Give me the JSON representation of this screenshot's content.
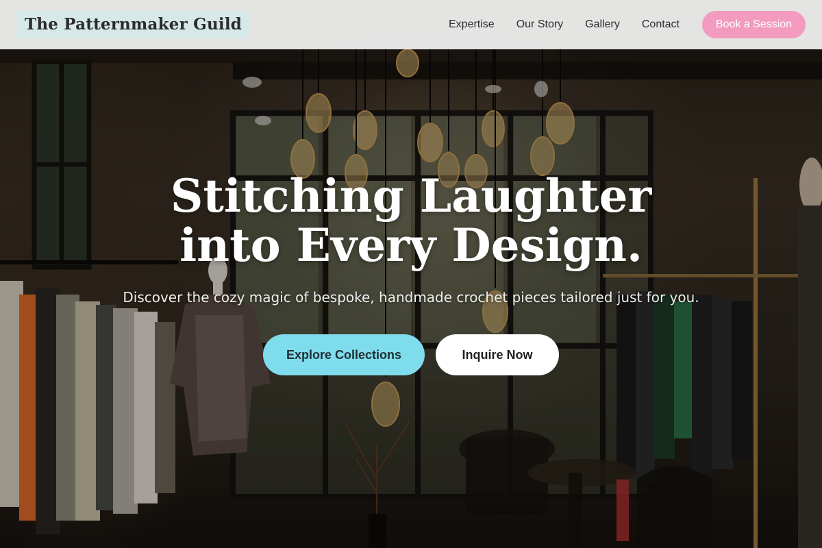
{
  "header": {
    "brand": "The Patternmaker Guild",
    "nav": [
      {
        "label": "Expertise"
      },
      {
        "label": "Our Story"
      },
      {
        "label": "Gallery"
      },
      {
        "label": "Contact"
      }
    ],
    "cta_label": "Book a Session"
  },
  "hero": {
    "headline": "Stitching Laughter into Every Design.",
    "subheading": "Discover the cozy magic of bespoke, handmade crochet pieces tailored just for you.",
    "primary_button": "Explore Collections",
    "secondary_button": "Inquire Now",
    "background_icon": "boutique-interior-photo"
  },
  "colors": {
    "header_bg": "#ececec",
    "brand_bg": "#d6e8e8",
    "cta_pink": "#f29bbf",
    "primary_button": "#7fdcec",
    "secondary_button": "#ffffff",
    "headline": "#ffffff"
  }
}
